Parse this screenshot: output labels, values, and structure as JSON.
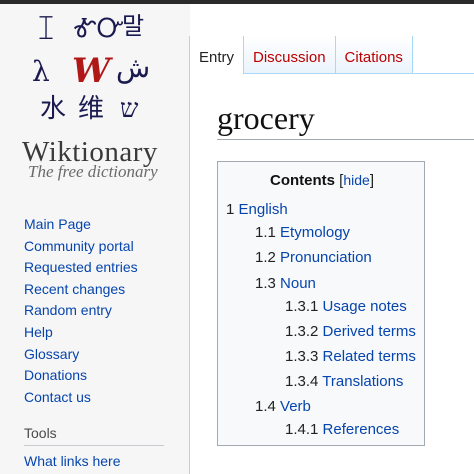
{
  "logo": {
    "glyphs": [
      "ꀤ",
      "ᎹᏅ",
      "말",
      "λ",
      "W",
      "ش",
      "水",
      "维",
      "ש"
    ],
    "brand_name": "Wiktionary",
    "tagline": "The free dictionary"
  },
  "sidebar": {
    "nav_items": [
      "Main Page",
      "Community portal",
      "Requested entries",
      "Recent changes",
      "Random entry",
      "Help",
      "Glossary",
      "Donations",
      "Contact us"
    ],
    "tools_heading": "Tools",
    "tools_items": [
      "What links here"
    ]
  },
  "tabs": [
    {
      "label": "Entry",
      "selected": true
    },
    {
      "label": "Discussion",
      "selected": false
    },
    {
      "label": "Citations",
      "selected": false
    }
  ],
  "page": {
    "title": "grocery"
  },
  "toc": {
    "heading": "Contents",
    "hide_label": "hide",
    "items": [
      {
        "num": "1",
        "text": "English"
      },
      {
        "num": "1.1",
        "text": "Etymology"
      },
      {
        "num": "1.2",
        "text": "Pronunciation"
      },
      {
        "num": "1.3",
        "text": "Noun"
      },
      {
        "num": "1.3.1",
        "text": "Usage notes"
      },
      {
        "num": "1.3.2",
        "text": "Derived terms"
      },
      {
        "num": "1.3.3",
        "text": "Related terms"
      },
      {
        "num": "1.3.4",
        "text": "Translations"
      },
      {
        "num": "1.4",
        "text": "Verb"
      },
      {
        "num": "1.4.1",
        "text": "References"
      }
    ]
  },
  "colors": {
    "link": "#0645ad",
    "tab_inactive": "#bb0000",
    "border": "#a7d7f9"
  }
}
